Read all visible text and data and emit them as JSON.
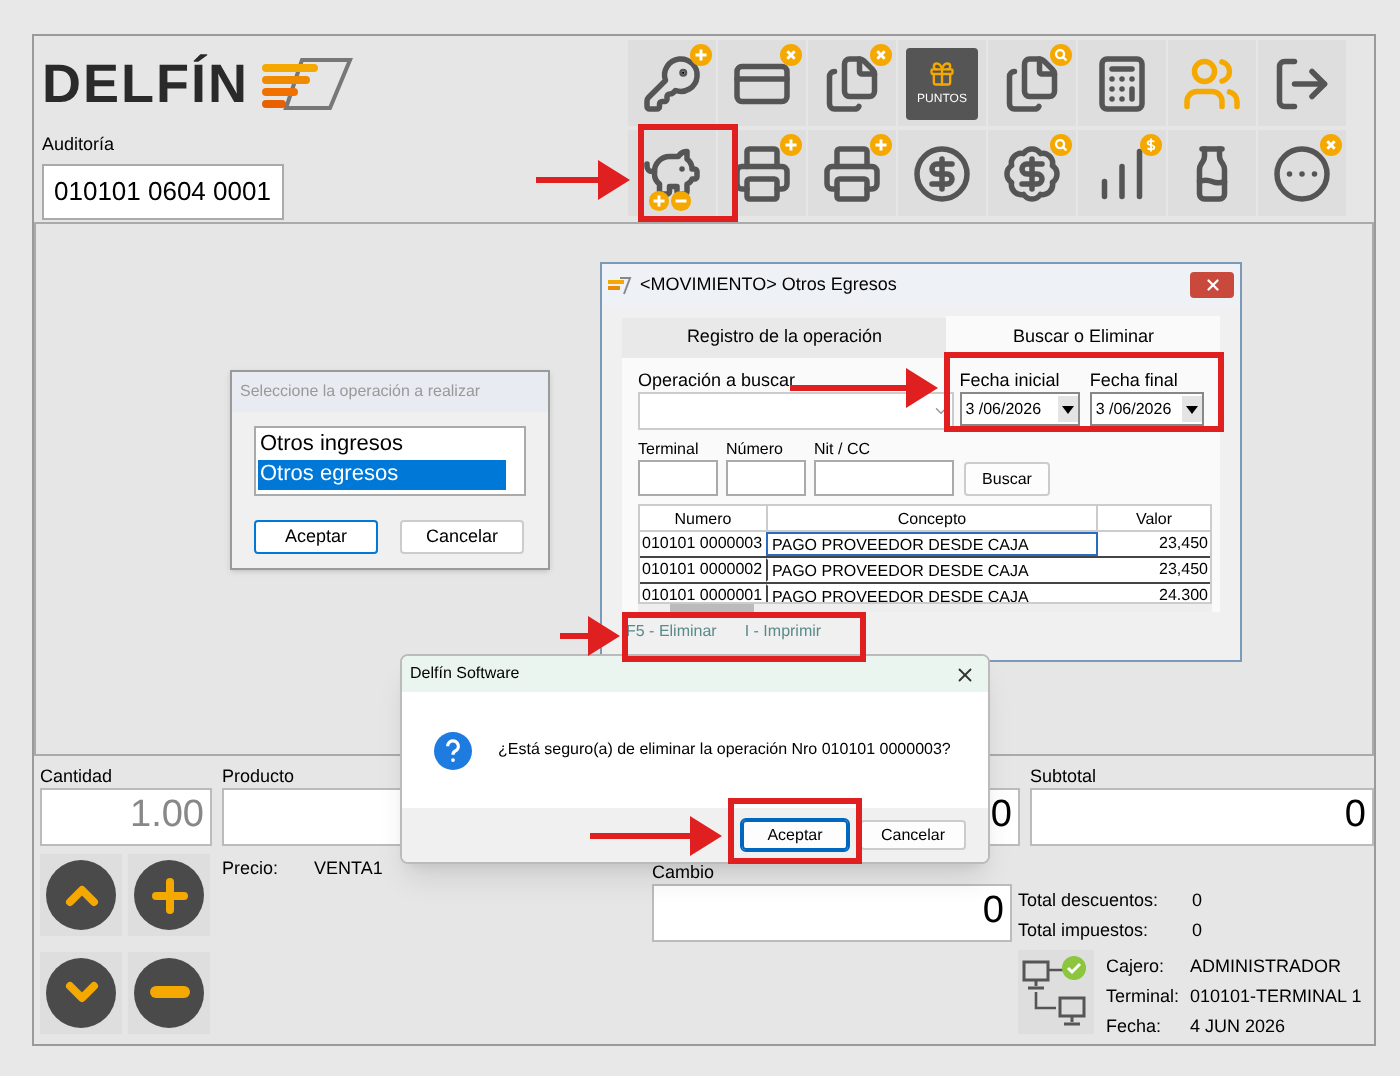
{
  "logo": {
    "text": "DELFÍN"
  },
  "toolbar": [
    [
      {
        "kind": "key-add"
      },
      {
        "kind": "card-remove"
      },
      {
        "kind": "documents-remove"
      },
      {
        "kind": "points",
        "label": "PUNTOS"
      },
      {
        "kind": "documents-search"
      },
      {
        "kind": "calculator"
      },
      {
        "kind": "users"
      },
      {
        "kind": "exit"
      }
    ],
    [
      {
        "kind": "piggy"
      },
      {
        "kind": "printer-add"
      },
      {
        "kind": "cash-printer"
      },
      {
        "kind": "coin-cycle"
      },
      {
        "kind": "coin-seal"
      },
      {
        "kind": "stairs"
      },
      {
        "kind": "bottles"
      },
      {
        "kind": "buttons-remove"
      }
    ]
  ],
  "auditoria": {
    "label": "Auditoría",
    "value": "010101 0604 0001"
  },
  "selector_dialog": {
    "title": "Seleccione la operación a realizar",
    "items": [
      {
        "label": "Otros ingresos",
        "selected": false
      },
      {
        "label": "Otros egresos",
        "selected": true
      }
    ],
    "buttons": [
      {
        "label": "Aceptar",
        "focused": true
      },
      {
        "label": "Cancelar",
        "focused": false
      }
    ]
  },
  "movimiento_window": {
    "title": "<MOVIMIENTO> Otros Egresos",
    "tabs": [
      {
        "label": "Registro de la operación",
        "selected": false
      },
      {
        "label": "Buscar o Eliminar",
        "selected": true
      }
    ],
    "operacion": {
      "label": "Operación a buscar"
    },
    "fecha_inicial": {
      "label": "Fecha inicial",
      "value": "3 /06/2026"
    },
    "fecha_final": {
      "label": "Fecha final",
      "value": "3 /06/2026"
    },
    "filters": [
      {
        "label": "Terminal"
      },
      {
        "label": "Número"
      },
      {
        "label": "Nit / CC"
      }
    ],
    "search_button": "Buscar",
    "table": {
      "columns": [
        "Numero",
        "Concepto",
        "Valor"
      ],
      "rows": [
        {
          "numero": "010101 0000003",
          "concepto": "PAGO PROVEEDOR DESDE CAJA",
          "valor": "23,450",
          "focused": true
        },
        {
          "numero": "010101 0000002",
          "concepto": "PAGO PROVEEDOR DESDE CAJA",
          "valor": "23,450",
          "focused": false
        },
        {
          "numero": "010101 0000001",
          "concepto": "PAGO PROVEEDOR DESDE CAJA",
          "valor": "24.300",
          "focused": false
        }
      ]
    },
    "shortcuts": [
      "F5 - Eliminar",
      "I - Imprimir"
    ]
  },
  "confirm_dialog": {
    "title": "Delfín Software",
    "message": "¿Está seguro(a) de eliminar la operación Nro 010101 0000003?",
    "buttons": [
      {
        "label": "Aceptar",
        "focused": true
      },
      {
        "label": "Cancelar",
        "focused": false
      }
    ]
  },
  "cantidad": {
    "label": "Cantidad",
    "value": "1.00"
  },
  "producto": {
    "label": "Producto"
  },
  "field_3": {
    "value": "0"
  },
  "subtotal": {
    "label": "Subtotal",
    "value": "0"
  },
  "nav_buttons": [
    {
      "kind": "up"
    },
    {
      "kind": "plus"
    },
    {
      "kind": "down"
    },
    {
      "kind": "minus"
    }
  ],
  "precio": {
    "label": "Precio:",
    "value": "VENTA1"
  },
  "cambio": {
    "label": "Cambio",
    "value": "0"
  },
  "totals": [
    {
      "label": "Total descuentos:",
      "value": "0"
    },
    {
      "label": "Total impuestos:",
      "value": "0"
    }
  ],
  "session": [
    {
      "label": "Cajero:",
      "value": "ADMINISTRADOR"
    },
    {
      "label": "Terminal:",
      "value": "010101-TERMINAL 1"
    },
    {
      "label": "Fecha:",
      "value": "4 JUN 2026"
    }
  ]
}
